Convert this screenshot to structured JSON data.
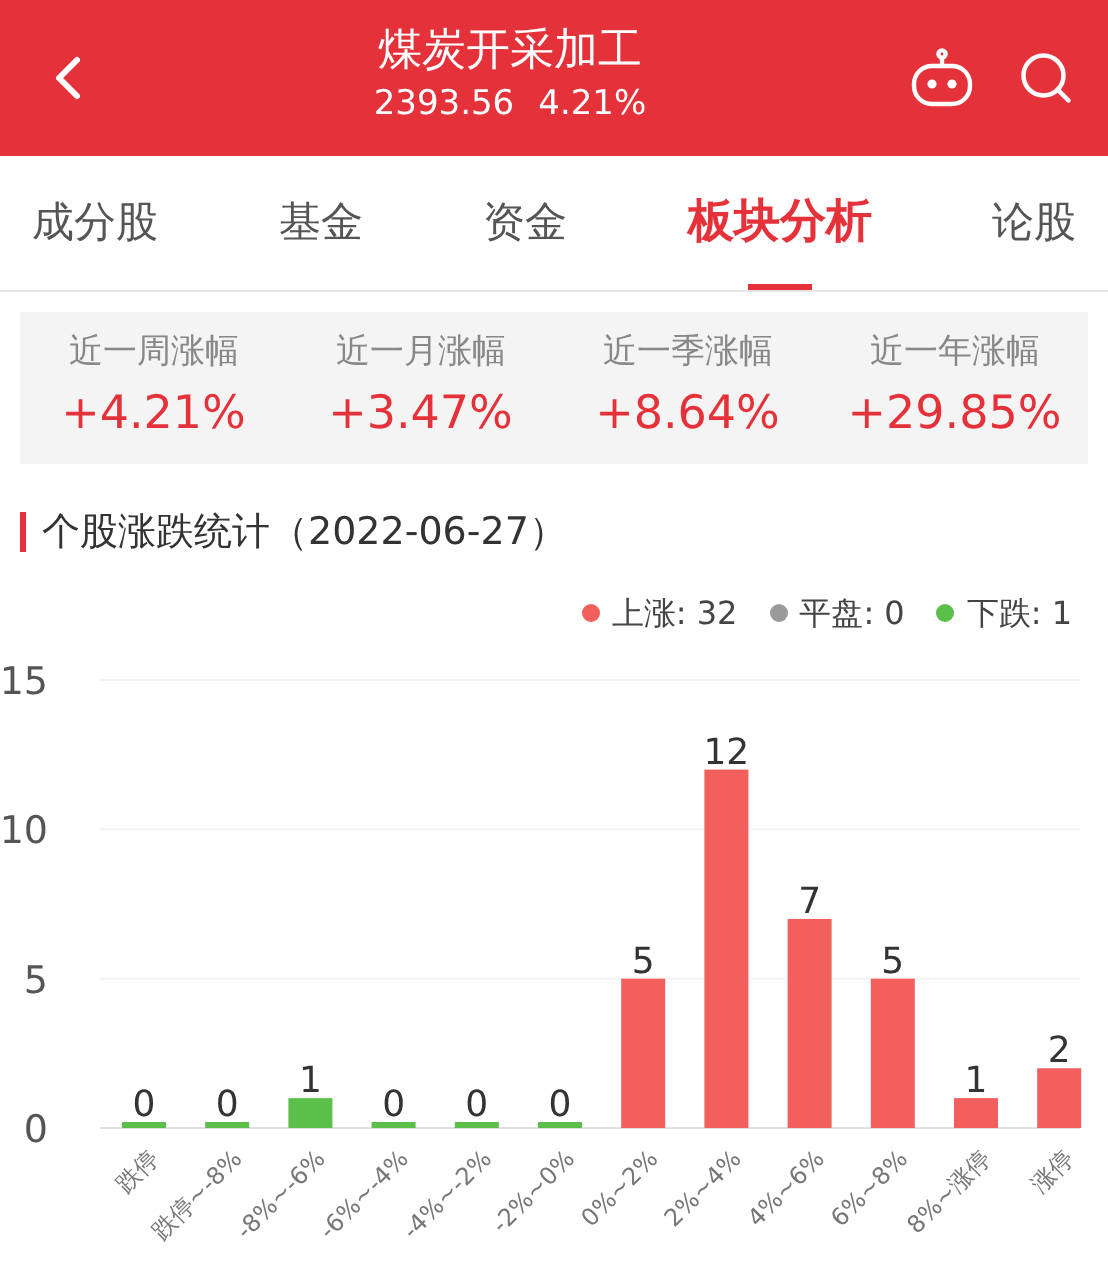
{
  "header": {
    "title": "煤炭开采加工",
    "price": "2393.56",
    "change": "4.21%"
  },
  "tabs": [
    {
      "label": "成分股",
      "selected": false
    },
    {
      "label": "基金",
      "selected": false
    },
    {
      "label": "资金",
      "selected": false
    },
    {
      "label": "板块分析",
      "selected": true
    },
    {
      "label": "论股",
      "selected": false
    }
  ],
  "summary": [
    {
      "label": "近一周涨幅",
      "value": "+4.21%"
    },
    {
      "label": "近一月涨幅",
      "value": "+3.47%"
    },
    {
      "label": "近一季涨幅",
      "value": "+8.64%"
    },
    {
      "label": "近一年涨幅",
      "value": "+29.85%"
    }
  ],
  "section_title": "个股涨跌统计（2022-06-27）",
  "legend": [
    {
      "label": "上涨: 32",
      "color": "#f25f5c"
    },
    {
      "label": "平盘: 0",
      "color": "#9a9a9a"
    },
    {
      "label": "下跌: 1",
      "color": "#5cbf4a"
    }
  ],
  "chart_data": {
    "type": "bar",
    "categories": [
      "跌停",
      "跌停~-8%",
      "-8%~-6%",
      "-6%~-4%",
      "-4%~-2%",
      "-2%~0%",
      "0%~2%",
      "2%~4%",
      "4%~6%",
      "6%~8%",
      "8%~涨停",
      "涨停"
    ],
    "series": [
      {
        "color": "#5cbf4a",
        "values": [
          0,
          0,
          1,
          0,
          0,
          0,
          null,
          null,
          null,
          null,
          null,
          null
        ]
      },
      {
        "color": "#f25f5c",
        "values": [
          null,
          null,
          null,
          null,
          null,
          null,
          5,
          12,
          7,
          5,
          1,
          2
        ]
      }
    ],
    "ylim": [
      0,
      15
    ],
    "yticks": [
      0,
      5,
      10,
      15
    ],
    "data_labels": true
  }
}
